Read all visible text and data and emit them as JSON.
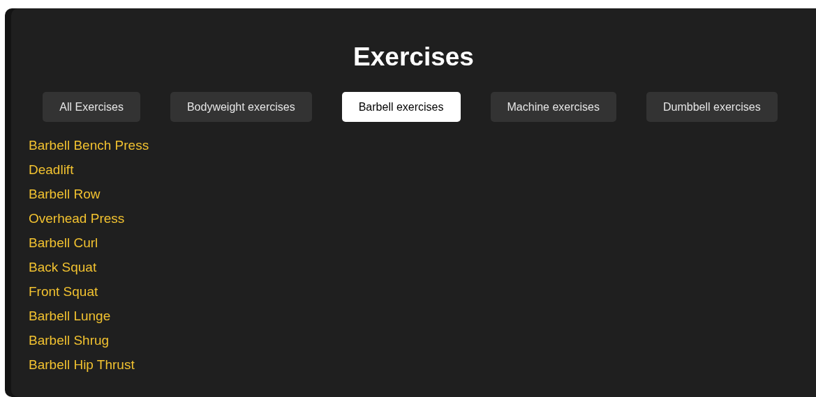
{
  "title": "Exercises",
  "tabs": [
    {
      "label": "All Exercises",
      "selected": false
    },
    {
      "label": "Bodyweight exercises",
      "selected": false
    },
    {
      "label": "Barbell exercises",
      "selected": true
    },
    {
      "label": "Machine exercises",
      "selected": false
    },
    {
      "label": "Dumbbell exercises",
      "selected": false
    }
  ],
  "exercises": [
    "Barbell Bench Press",
    "Deadlift",
    "Barbell Row",
    "Overhead Press",
    "Barbell Curl",
    "Back Squat",
    "Front Squat",
    "Barbell Lunge",
    "Barbell Shrug",
    "Barbell Hip Thrust"
  ]
}
